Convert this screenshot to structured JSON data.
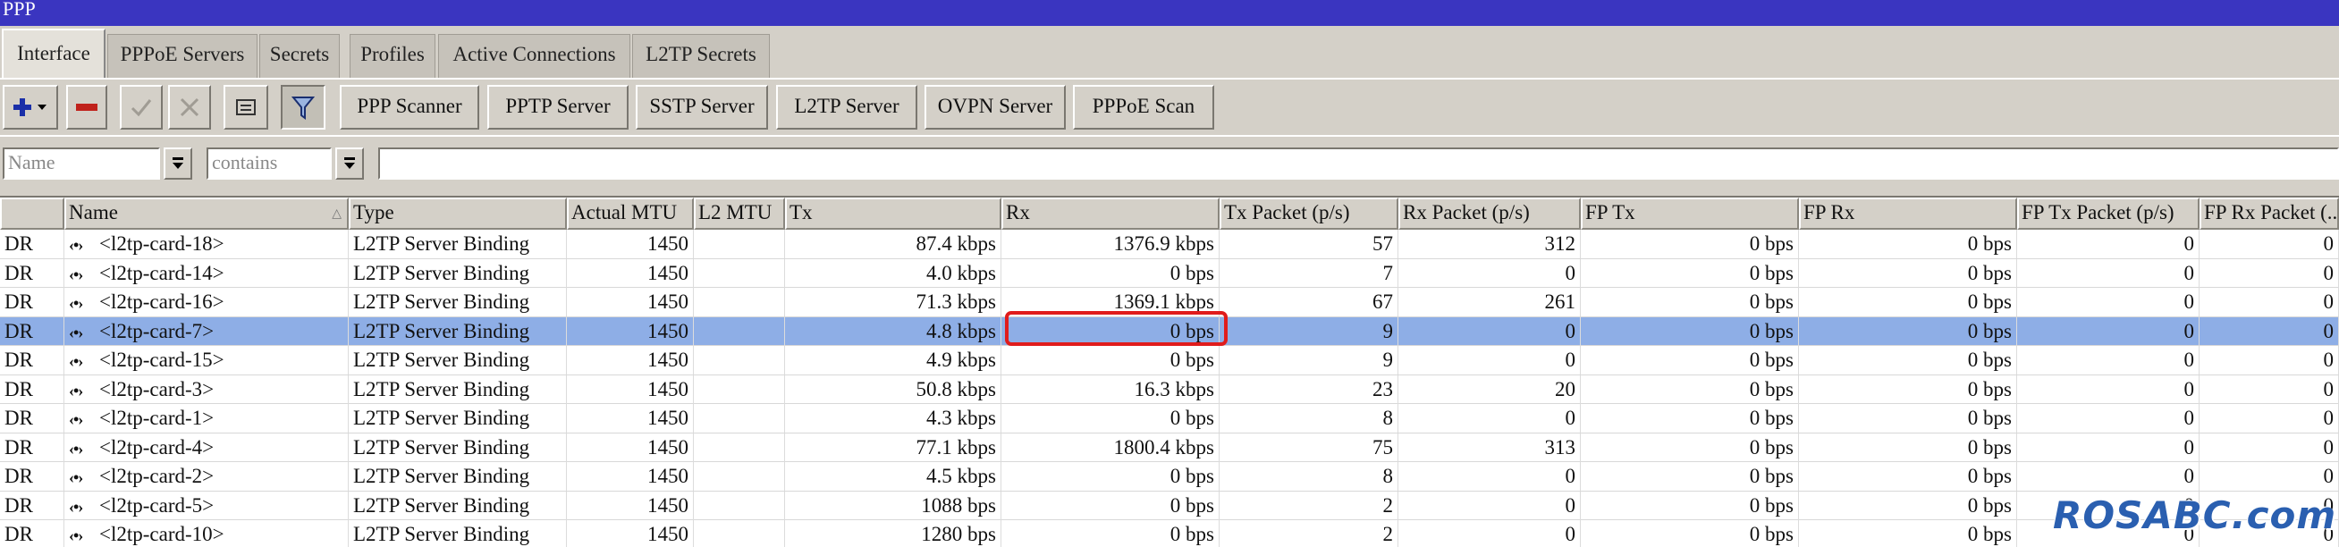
{
  "window": {
    "title": "PPP"
  },
  "tabs": [
    {
      "label": "Interface"
    },
    {
      "label": "PPPoE Servers"
    },
    {
      "label": "Secrets"
    },
    {
      "label": "Profiles"
    },
    {
      "label": "Active Connections"
    },
    {
      "label": "L2TP Secrets"
    }
  ],
  "toolbar": {
    "buttons": [
      {
        "label": "PPP Scanner"
      },
      {
        "label": "PPTP Server"
      },
      {
        "label": "SSTP Server"
      },
      {
        "label": "L2TP Server"
      },
      {
        "label": "OVPN Server"
      },
      {
        "label": "PPPoE Scan"
      }
    ],
    "icons": [
      "add-icon",
      "remove-icon",
      "enable-check-icon",
      "disable-x-icon",
      "comment-icon",
      "filter-icon"
    ]
  },
  "filter": {
    "field_placeholder": "Name",
    "operator_placeholder": "contains",
    "value": ""
  },
  "table": {
    "columns": [
      "",
      "Name",
      "Type",
      "Actual MTU",
      "L2 MTU",
      "Tx",
      "Rx",
      "Tx Packet (p/s)",
      "Rx Packet (p/s)",
      "FP Tx",
      "FP Rx",
      "FP Tx Packet (p/s)",
      "FP Rx Packet (..."
    ],
    "rows": [
      {
        "flags": "DR",
        "name": "<l2tp-card-18>",
        "type": "L2TP Server Binding",
        "mtu": "1450",
        "l2mtu": "",
        "tx": "87.4 kbps",
        "rx": "1376.9 kbps",
        "txp": "57",
        "rxp": "312",
        "fptx": "0 bps",
        "fprx": "0 bps",
        "fptxp": "0",
        "fprxp": "0"
      },
      {
        "flags": "DR",
        "name": "<l2tp-card-14>",
        "type": "L2TP Server Binding",
        "mtu": "1450",
        "l2mtu": "",
        "tx": "4.0 kbps",
        "rx": "0 bps",
        "txp": "7",
        "rxp": "0",
        "fptx": "0 bps",
        "fprx": "0 bps",
        "fptxp": "0",
        "fprxp": "0"
      },
      {
        "flags": "DR",
        "name": "<l2tp-card-16>",
        "type": "L2TP Server Binding",
        "mtu": "1450",
        "l2mtu": "",
        "tx": "71.3 kbps",
        "rx": "1369.1 kbps",
        "txp": "67",
        "rxp": "261",
        "fptx": "0 bps",
        "fprx": "0 bps",
        "fptxp": "0",
        "fprxp": "0"
      },
      {
        "flags": "DR",
        "name": "<l2tp-card-7>",
        "type": "L2TP Server Binding",
        "mtu": "1450",
        "l2mtu": "",
        "tx": "4.8 kbps",
        "rx": "0 bps",
        "txp": "9",
        "rxp": "0",
        "fptx": "0 bps",
        "fprx": "0 bps",
        "fptxp": "0",
        "fprxp": "0"
      },
      {
        "flags": "DR",
        "name": "<l2tp-card-15>",
        "type": "L2TP Server Binding",
        "mtu": "1450",
        "l2mtu": "",
        "tx": "4.9 kbps",
        "rx": "0 bps",
        "txp": "9",
        "rxp": "0",
        "fptx": "0 bps",
        "fprx": "0 bps",
        "fptxp": "0",
        "fprxp": "0"
      },
      {
        "flags": "DR",
        "name": "<l2tp-card-3>",
        "type": "L2TP Server Binding",
        "mtu": "1450",
        "l2mtu": "",
        "tx": "50.8 kbps",
        "rx": "16.3 kbps",
        "txp": "23",
        "rxp": "20",
        "fptx": "0 bps",
        "fprx": "0 bps",
        "fptxp": "0",
        "fprxp": "0"
      },
      {
        "flags": "DR",
        "name": "<l2tp-card-1>",
        "type": "L2TP Server Binding",
        "mtu": "1450",
        "l2mtu": "",
        "tx": "4.3 kbps",
        "rx": "0 bps",
        "txp": "8",
        "rxp": "0",
        "fptx": "0 bps",
        "fprx": "0 bps",
        "fptxp": "0",
        "fprxp": "0"
      },
      {
        "flags": "DR",
        "name": "<l2tp-card-4>",
        "type": "L2TP Server Binding",
        "mtu": "1450",
        "l2mtu": "",
        "tx": "77.1 kbps",
        "rx": "1800.4 kbps",
        "txp": "75",
        "rxp": "313",
        "fptx": "0 bps",
        "fprx": "0 bps",
        "fptxp": "0",
        "fprxp": "0"
      },
      {
        "flags": "DR",
        "name": "<l2tp-card-2>",
        "type": "L2TP Server Binding",
        "mtu": "1450",
        "l2mtu": "",
        "tx": "4.5 kbps",
        "rx": "0 bps",
        "txp": "8",
        "rxp": "0",
        "fptx": "0 bps",
        "fprx": "0 bps",
        "fptxp": "0",
        "fprxp": "0"
      },
      {
        "flags": "DR",
        "name": "<l2tp-card-5>",
        "type": "L2TP Server Binding",
        "mtu": "1450",
        "l2mtu": "",
        "tx": "1088 bps",
        "rx": "0 bps",
        "txp": "2",
        "rxp": "0",
        "fptx": "0 bps",
        "fprx": "0 bps",
        "fptxp": "0",
        "fprxp": "0"
      },
      {
        "flags": "DR",
        "name": "<l2tp-card-10>",
        "type": "L2TP Server Binding",
        "mtu": "1450",
        "l2mtu": "",
        "tx": "1280 bps",
        "rx": "0 bps",
        "txp": "2",
        "rxp": "0",
        "fptx": "0 bps",
        "fprx": "0 bps",
        "fptxp": "0",
        "fprxp": "0"
      }
    ],
    "selected_row": 3,
    "sort_column": "Name"
  },
  "watermark": "ROSABC.com",
  "colors": {
    "titlebar": "#3a35c0",
    "selection": "#8eaee6",
    "highlight": "#e01c1c"
  }
}
